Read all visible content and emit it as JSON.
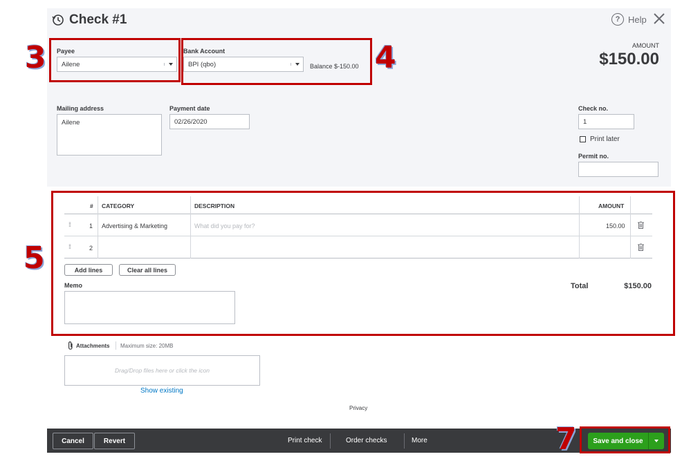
{
  "header": {
    "title": "Check #1",
    "help_label": "Help"
  },
  "payee": {
    "label": "Payee",
    "value": "Ailene"
  },
  "bank_account": {
    "label": "Bank Account",
    "value": "BPI (qbo)",
    "balance": "Balance $-150.00"
  },
  "amount": {
    "label": "AMOUNT",
    "value": "$150.00"
  },
  "mailing_address": {
    "label": "Mailing address",
    "value": "Ailene"
  },
  "payment_date": {
    "label": "Payment date",
    "value": "02/26/2020"
  },
  "check_no": {
    "label": "Check no.",
    "value": "1"
  },
  "print_later": {
    "label": "Print later",
    "checked": false
  },
  "permit_no": {
    "label": "Permit no.",
    "value": ""
  },
  "table": {
    "headers": {
      "num": "#",
      "category": "CATEGORY",
      "description": "DESCRIPTION",
      "amount": "AMOUNT"
    },
    "rows": [
      {
        "num": "1",
        "category": "Advertising & Marketing",
        "description": "",
        "description_placeholder": "What did you pay for?",
        "amount": "150.00"
      },
      {
        "num": "2",
        "category": "",
        "description": "",
        "amount": ""
      }
    ]
  },
  "buttons": {
    "add_lines": "Add lines",
    "clear_all_lines": "Clear all lines"
  },
  "memo": {
    "label": "Memo"
  },
  "total": {
    "label": "Total",
    "value": "$150.00"
  },
  "attachments": {
    "label": "Attachments",
    "max_size": "Maximum size: 20MB",
    "dropzone": "Drag/Drop files here or click the icon",
    "show_existing": "Show existing"
  },
  "privacy": "Privacy",
  "footer": {
    "cancel": "Cancel",
    "revert": "Revert",
    "print_check": "Print check",
    "order_checks": "Order checks",
    "more": "More",
    "save_and_close": "Save and close"
  },
  "annotations": {
    "a3": "3",
    "a4": "4",
    "a5": "5",
    "a7": "7"
  },
  "colors": {
    "accent_green": "#2ca01c",
    "annotation_red": "#c00000",
    "footer_bg": "#393a3d"
  }
}
